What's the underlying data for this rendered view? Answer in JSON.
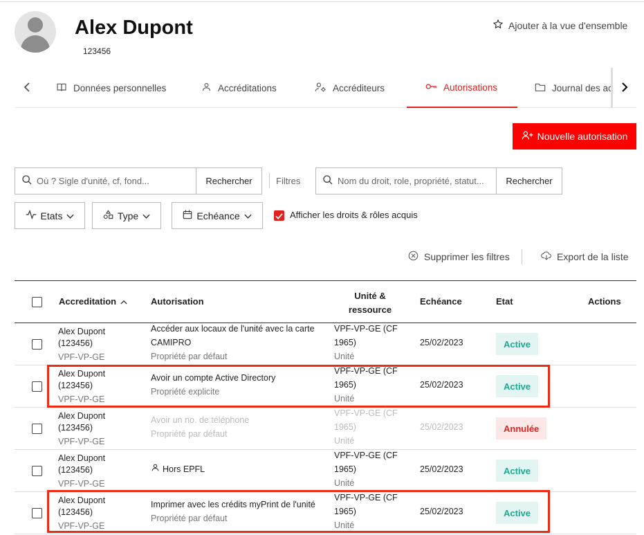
{
  "header": {
    "name": "Alex Dupont",
    "sciper": "123456",
    "add_overview": "Ajouter à la vue d'ensemble"
  },
  "tabs": [
    {
      "label": "Données personnelles",
      "icon": "book-icon"
    },
    {
      "label": "Accréditations",
      "icon": "person-icon"
    },
    {
      "label": "Accréditeurs",
      "icon": "person-gear-icon"
    },
    {
      "label": "Autorisations",
      "icon": "key-icon",
      "active": true
    },
    {
      "label": "Journal des activités",
      "icon": "folder-icon"
    }
  ],
  "actions": {
    "new_authorization": "Nouvelle autorisation"
  },
  "filters": {
    "unit_search_placeholder": "Où ? Sigle d'unité, cf, fond...",
    "unit_search_button": "Rechercher",
    "filters_label": "Filtres",
    "right_search_placeholder": "Nom du droit, role, propriété, statut...",
    "right_search_button": "Rechercher",
    "states": "Etats",
    "type": "Type",
    "deadline": "Echéance",
    "show_acquired": "Afficher les droits & rôles acquis",
    "show_acquired_checked": true
  },
  "list_actions": {
    "clear_filters": "Supprimer les filtres",
    "export": "Export de la liste"
  },
  "table": {
    "columns": {
      "accreditation": "Accreditation",
      "authorization": "Autorisation",
      "unit_l1": "Unité &",
      "unit_l2": "ressource",
      "deadline": "Echéance",
      "state": "Etat",
      "actions": "Actions"
    },
    "rows": [
      {
        "person": "Alex Dupont",
        "person_id": "(123456)",
        "unit": "VPF-VP-GE",
        "auth_l1": "Accéder aux locaux de l'unité avec la carte",
        "auth_l2": "CAMIPRO",
        "auth_sub": "Propriété  par défaut",
        "res_l1": "VPF-VP-GE (CF",
        "res_l2": "1965)",
        "res_l3": "Unité",
        "deadline": "25/02/2023",
        "state": "Active"
      },
      {
        "person": "Alex Dupont",
        "person_id": "(123456)",
        "unit": "VPF-VP-GE",
        "auth_l1": "Avoir un compte Active Directory",
        "auth_sub": "Propriété  explicite",
        "res_l1": "VPF-VP-GE (CF",
        "res_l2": "1965)",
        "res_l3": "Unité",
        "deadline": "25/02/2023",
        "state": "Active"
      },
      {
        "person": "Alex Dupont",
        "person_id": "(123456)",
        "unit": "VPF-VP-GE",
        "auth_l1": "Avoir un no. de téléphone",
        "auth_sub": "Propriété  par défaut",
        "res_l1": "VPF-VP-GE (CF",
        "res_l2": "1965)",
        "res_l3": "Unité",
        "deadline": "25/02/2023",
        "state": "Annulée"
      },
      {
        "person": "Alex Dupont",
        "person_id": "(123456)",
        "unit": "VPF-VP-GE",
        "auth_l1": "Hors EPFL",
        "res_l1": "VPF-VP-GE (CF",
        "res_l2": "1965)",
        "res_l3": "Unité",
        "deadline": "25/02/2023",
        "state": "Active"
      },
      {
        "person": "Alex Dupont",
        "person_id": "(123456)",
        "unit": "VPF-VP-GE",
        "auth_l1": "Imprimer avec les crédits myPrint de l'unité",
        "auth_sub": "Propriété  par défaut",
        "res_l1": "VPF-VP-GE (CF",
        "res_l2": "1965)",
        "res_l3": "Unité",
        "deadline": "25/02/2023",
        "state": "Active"
      }
    ]
  },
  "colors": {
    "accent": "#e2201d",
    "active_text": "#1aa98f",
    "active_bg": "#e3f5f2",
    "cancel_bg": "#fde6e6",
    "highlight": "#ee2b12"
  }
}
